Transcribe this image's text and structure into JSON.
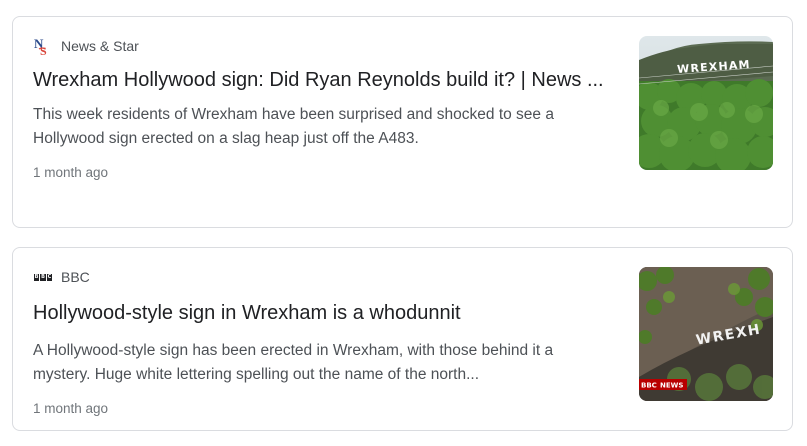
{
  "results": [
    {
      "source": "News & Star",
      "source_logo_icon": "news-and-star-logo-icon",
      "headline": "Wrexham Hollywood sign: Did Ryan Reynolds build it? | News ...",
      "snippet": "This week residents of Wrexham have been surprised and shocked to see a Hollywood sign erected on a slag heap just off the A483.",
      "age": "1 month ago",
      "thumb_sign_text": "WREXHAM"
    },
    {
      "source": "BBC",
      "source_logo_icon": "bbc-logo-icon",
      "headline": "Hollywood-style sign in Wrexham is a whodunnit",
      "snippet": "A Hollywood-style sign has been erected in Wrexham, with those behind it a mystery. Huge white lettering spelling out the name of the north...",
      "age": "1 month ago",
      "thumb_sign_text": "WREXH",
      "thumb_badge_bbc": "BBC",
      "thumb_badge_news": "NEWS"
    }
  ],
  "colors": {
    "card_border": "#dadce0",
    "headline": "#202124",
    "snippet": "#4d5156",
    "meta": "#70757a",
    "bbc_red": "#b80000"
  }
}
